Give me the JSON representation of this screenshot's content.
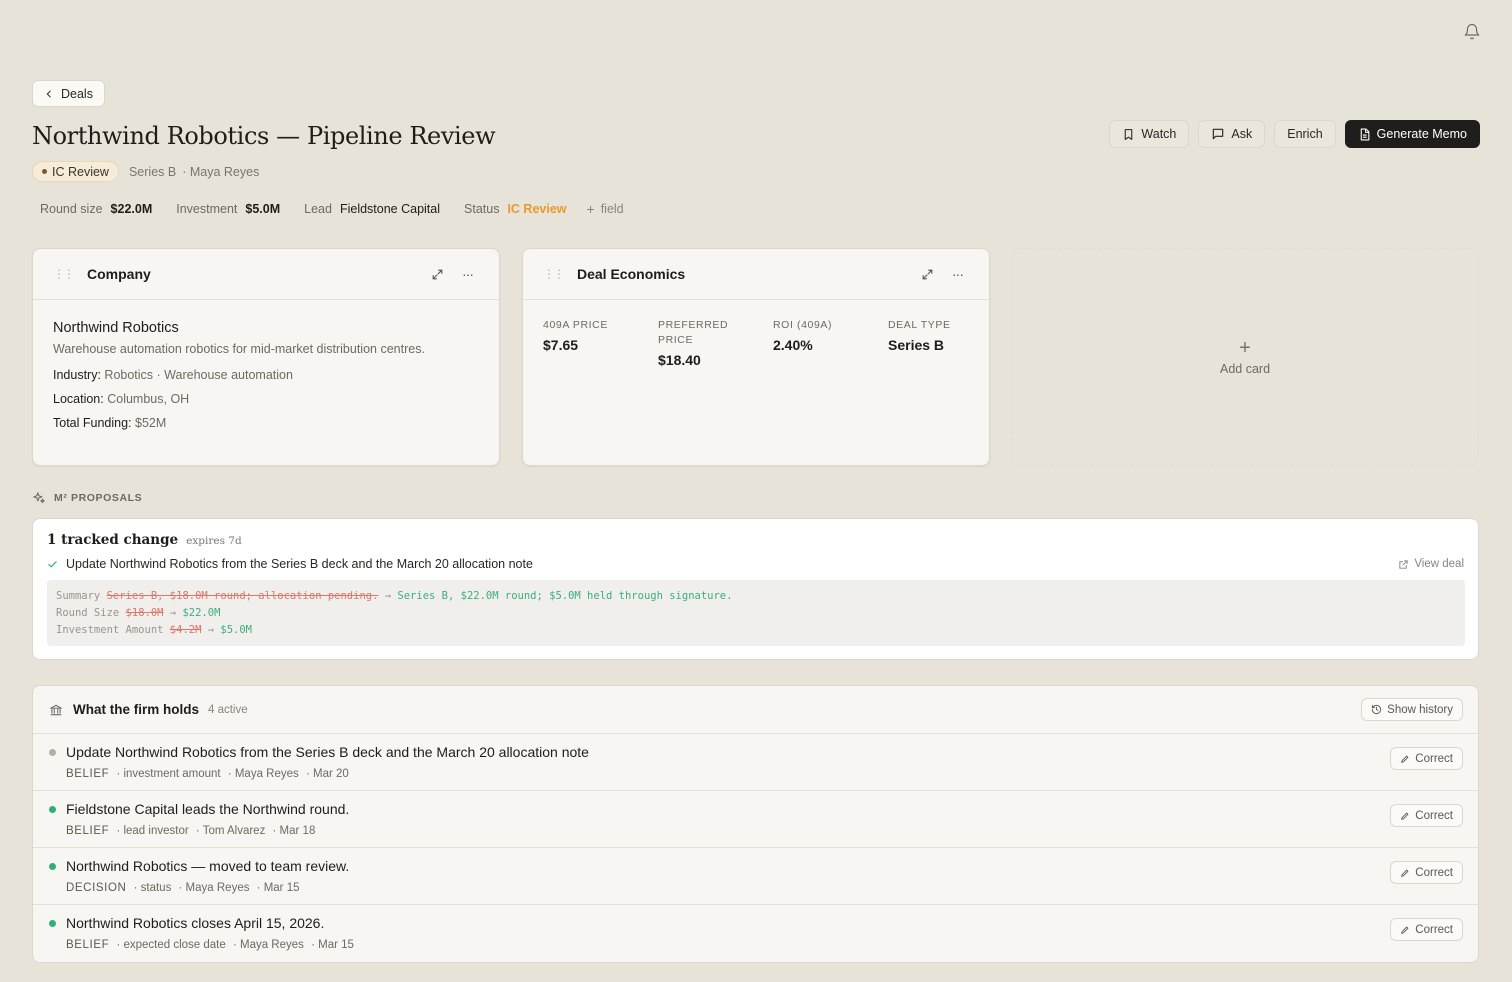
{
  "nav": {
    "back_label": "Deals"
  },
  "header": {
    "title": "Northwind Robotics — Pipeline Review",
    "status_pill": "IC Review",
    "series": "Series B",
    "owner": "· Maya Reyes"
  },
  "actions": {
    "watch": "Watch",
    "ask": "Ask",
    "enrich": "Enrich",
    "generate": "Generate Memo"
  },
  "fields": {
    "round_size_label": "Round size",
    "round_size_value": "$22.0M",
    "investment_label": "Investment",
    "investment_value": "$5.0M",
    "lead_label": "Lead",
    "lead_value": "Fieldstone Capital",
    "status_label": "Status",
    "status_value": "IC Review",
    "add_field": "field"
  },
  "company_card": {
    "title": "Company",
    "name": "Northwind Robotics",
    "description": "Warehouse automation robotics for mid-market distribution centres.",
    "industry_label": "Industry:",
    "industry_value": "Robotics · Warehouse automation",
    "location_label": "Location:",
    "location_value": "Columbus, OH",
    "funding_label": "Total Funding:",
    "funding_value": "$52M"
  },
  "economics_card": {
    "title": "Deal Economics",
    "metrics": [
      {
        "label": "409A PRICE",
        "value": "$7.65"
      },
      {
        "label": "PREFERRED PRICE",
        "value": "$18.40"
      },
      {
        "label": "ROI (409A)",
        "value": "2.40%"
      },
      {
        "label": "DEAL TYPE",
        "value": "Series B"
      }
    ]
  },
  "add_card": {
    "label": "Add card"
  },
  "proposals": {
    "section_label": "M² PROPOSALS",
    "title": "1 tracked change",
    "expires": "expires 7d",
    "description": "Update Northwind Robotics from the Series B deck and the March 20 allocation note",
    "view_deal": "View deal",
    "diffs": [
      {
        "field": "Summary",
        "old": "Series B, $18.0M round; allocation pending.",
        "new": "Series B, $22.0M round; $5.0M held through signature."
      },
      {
        "field": "Round Size",
        "old": "$18.0M",
        "new": "$22.0M"
      },
      {
        "field": "Investment Amount",
        "old": "$4.2M",
        "new": "$5.0M"
      }
    ]
  },
  "holds": {
    "title": "What the firm holds",
    "count": "4 active",
    "show_history": "Show history",
    "correct_label": "Correct",
    "items": [
      {
        "title": "Update Northwind Robotics from the Series B deck and the March 20 allocation note",
        "type": "BELIEF",
        "field": "· investment amount",
        "author": "· Maya Reyes",
        "date": "· Mar 20",
        "dot_color": "#b5b0a6"
      },
      {
        "title": "Fieldstone Capital leads the Northwind round.",
        "type": "BELIEF",
        "field": "· lead investor",
        "author": "· Tom Alvarez",
        "date": "· Mar 18",
        "dot_color": "#2fae76"
      },
      {
        "title": "Northwind Robotics — moved to team review.",
        "type": "DECISION",
        "field": "· status",
        "author": "· Maya Reyes",
        "date": "· Mar 15",
        "dot_color": "#2fae76"
      },
      {
        "title": "Northwind Robotics closes April 15, 2026.",
        "type": "BELIEF",
        "field": "· expected close date",
        "author": "· Maya Reyes",
        "date": "· Mar 15",
        "dot_color": "#2fae76"
      }
    ]
  },
  "colors": {
    "accent_status": "#e89a2c",
    "primary_button": "#1f1e1c",
    "diff_old": "#d9786c",
    "diff_new": "#3cae7e"
  },
  "icons": [
    "bell-icon",
    "chevron-left-icon",
    "bookmark-icon",
    "chat-icon",
    "document-icon",
    "plus-icon",
    "drag-handle-icon",
    "expand-icon",
    "more-icon",
    "sparkle-icon",
    "check-icon",
    "external-link-icon",
    "bank-icon",
    "history-icon",
    "pencil-icon"
  ]
}
